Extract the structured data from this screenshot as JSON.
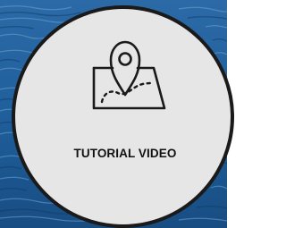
{
  "tile": {
    "label": "TUTORIAL VIDEO",
    "icon": "map-location-icon",
    "colors": {
      "background_water": "#1f5f9c",
      "circle_fill": "#e6e6e6",
      "circle_border": "#1a1a1a",
      "label_text": "#111111",
      "icon_stroke": "#1a1a1a"
    }
  }
}
